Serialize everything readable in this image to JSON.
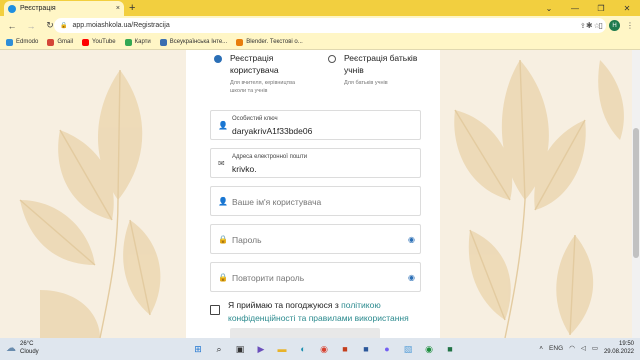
{
  "browser": {
    "tab_title": "Реєстрація",
    "tab_close": "×",
    "new_tab": "+",
    "url": "app.moiashkola.ua/Registracija",
    "bookmarks": [
      {
        "label": "Edmodo",
        "icon": "edmodo-icon",
        "color": "#2f8fd8"
      },
      {
        "label": "Gmail",
        "icon": "gmail-icon",
        "color": "#d44638"
      },
      {
        "label": "YouTube",
        "icon": "youtube-icon",
        "color": "#ff0000"
      },
      {
        "label": "Карти",
        "icon": "maps-icon",
        "color": "#34a853"
      },
      {
        "label": "Всеукраїнська Інте...",
        "icon": "bookmark-site-icon",
        "color": "#3b6fb0"
      },
      {
        "label": "Blender. Текстові о...",
        "icon": "bookmark-site-icon",
        "color": "#e87d0d"
      }
    ],
    "avatar_letter": "H"
  },
  "form": {
    "radio_user": {
      "label": "Реєстрація користувача",
      "sub": "Для вчителя, керівництва школи та учнів",
      "selected": true
    },
    "radio_parents": {
      "label": "Реєстрація батьків учнів",
      "sub": "Для батьків учнів",
      "selected": false
    },
    "personal_key": {
      "label": "Особистий ключ",
      "value": "daryakrivA1f33bde06"
    },
    "email": {
      "label": "Адреса електронної пошти",
      "value": "krivko."
    },
    "username": {
      "placeholder": "Ваше ім'я користувача"
    },
    "password": {
      "placeholder": "Пароль"
    },
    "password_repeat": {
      "placeholder": "Повторити пароль"
    },
    "agree": {
      "text": "Я приймаю та погоджуюся з",
      "link": "політикою конфіденційності та правилами використання"
    }
  },
  "taskbar": {
    "temperature": "26°C",
    "weather": "Cloudy",
    "language": "ENG",
    "time": "19:50",
    "date": "29.08.2022"
  },
  "colors": {
    "accent": "#2b8a8e",
    "radio_selected": "#2b6fb6",
    "tabstrip": "#f2cf3f",
    "decor": "#ebd6b1"
  }
}
